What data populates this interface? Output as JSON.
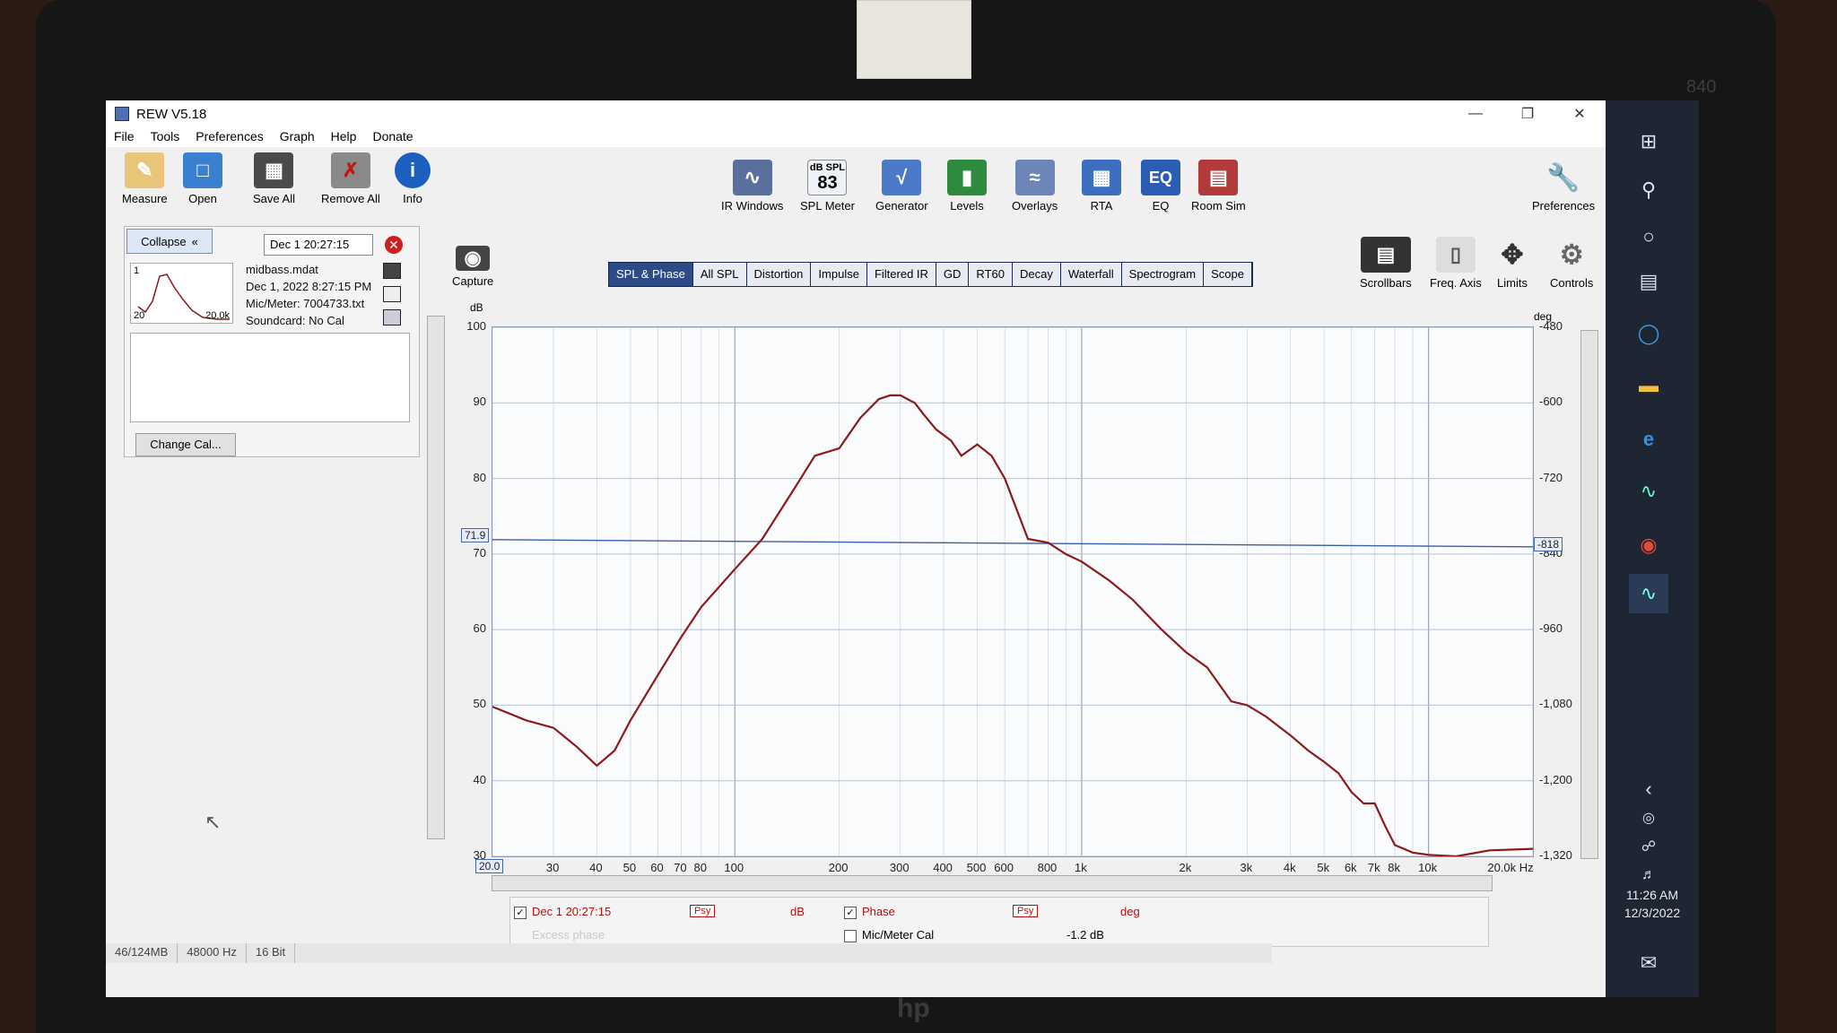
{
  "window": {
    "title": "REW V5.18"
  },
  "menu": [
    "File",
    "Tools",
    "Preferences",
    "Graph",
    "Help",
    "Donate"
  ],
  "toolbar": {
    "left": [
      {
        "label": "Measure",
        "icon": "measure-icon"
      },
      {
        "label": "Open",
        "icon": "folder-icon"
      },
      {
        "label": "Save All",
        "icon": "save-icon"
      },
      {
        "label": "Remove All",
        "icon": "remove-icon"
      },
      {
        "label": "Info",
        "icon": "info-icon"
      }
    ],
    "center": [
      {
        "label": "IR Windows",
        "icon": "ir-windows-icon"
      },
      {
        "label": "SPL Meter",
        "icon": "spl-meter-icon",
        "badge_top": "dB SPL",
        "badge_value": "83"
      },
      {
        "label": "Generator",
        "icon": "generator-icon"
      },
      {
        "label": "Levels",
        "icon": "levels-icon"
      },
      {
        "label": "Overlays",
        "icon": "overlays-icon"
      },
      {
        "label": "RTA",
        "icon": "rta-icon"
      },
      {
        "label": "EQ",
        "icon": "eq-icon"
      },
      {
        "label": "Room Sim",
        "icon": "room-sim-icon"
      }
    ],
    "preferences": "Preferences",
    "graph_right": [
      {
        "label": "Scrollbars"
      },
      {
        "label": "Freq. Axis"
      },
      {
        "label": "Limits"
      },
      {
        "label": "Controls"
      }
    ]
  },
  "panel": {
    "collapse": "Collapse",
    "collapse_glyph": "«",
    "measurement_time": "Dec 1 20:27:15",
    "index": "1",
    "thumb_left": "20",
    "thumb_right": "20.0k",
    "file": "midbass.mdat",
    "date": "Dec 1, 2022 8:27:15 PM",
    "mic": "Mic/Meter: 7004733.txt",
    "soundcard": "Soundcard: No Cal",
    "change_cal": "Change Cal..."
  },
  "capture": "Capture",
  "tabs": [
    {
      "label": "SPL & Phase",
      "active": true
    },
    {
      "label": "All SPL"
    },
    {
      "label": "Distortion"
    },
    {
      "label": "Impulse"
    },
    {
      "label": "Filtered IR"
    },
    {
      "label": "GD"
    },
    {
      "label": "RT60"
    },
    {
      "label": "Decay"
    },
    {
      "label": "Waterfall"
    },
    {
      "label": "Spectrogram"
    },
    {
      "label": "Scope"
    }
  ],
  "chart_data": {
    "type": "line",
    "ylabel": "dB",
    "y2label": "deg",
    "xscale": "log",
    "xlim": [
      20,
      20000
    ],
    "ylim": [
      30,
      100
    ],
    "y2lim": [
      -1320,
      -480
    ],
    "y_ticks": [
      30,
      40,
      50,
      60,
      70,
      80,
      90,
      100
    ],
    "y2_ticks": [
      "-480",
      "-600",
      "-720",
      "-840",
      "-960",
      "-1,080",
      "-1,200",
      "-1,320"
    ],
    "x_ticks": [
      "30",
      "40",
      "50",
      "60",
      "70",
      "80",
      "100",
      "200",
      "300",
      "400",
      "500",
      "600",
      "800",
      "1k",
      "2k",
      "3k",
      "4k",
      "5k",
      "6k",
      "7k",
      "8k",
      "10k"
    ],
    "x_min_label": "20.0",
    "x_max_label": "20.0k Hz",
    "cursor_left": "71.9",
    "cursor_right": "-818",
    "grid": true,
    "series": [
      {
        "name": "Dec 1 20:27:15",
        "color": "#8b1a1a",
        "x": [
          20,
          25,
          30,
          35,
          40,
          45,
          50,
          60,
          70,
          80,
          100,
          120,
          150,
          170,
          200,
          230,
          260,
          280,
          300,
          330,
          350,
          380,
          420,
          450,
          500,
          550,
          600,
          700,
          800,
          900,
          1000,
          1200,
          1400,
          1700,
          2000,
          2300,
          2700,
          3000,
          3400,
          4000,
          4500,
          5000,
          5500,
          6000,
          6500,
          7000,
          7500,
          8000,
          9000,
          10000,
          12000,
          15000,
          20000
        ],
        "y": [
          49.8,
          48,
          47,
          44.5,
          42,
          44,
          48,
          54,
          59,
          63,
          68,
          72,
          79,
          83,
          84,
          88,
          90.5,
          91,
          91,
          90,
          88.5,
          86.5,
          85,
          83,
          84.5,
          83,
          80,
          72,
          71.5,
          70,
          69,
          66.5,
          64,
          60,
          57,
          55,
          50.5,
          50,
          48.5,
          46,
          44,
          42.5,
          41,
          38.5,
          37,
          37,
          34,
          31.5,
          30.5,
          30.2,
          30,
          30.8,
          31
        ]
      }
    ]
  },
  "legend": {
    "m_label": "Dec 1 20:27:15",
    "psy": "Psy",
    "db": "dB",
    "phase": "Phase",
    "deg": "deg",
    "excess": "Excess phase",
    "mic_cal": "Mic/Meter Cal",
    "offset": "-1.2 dB"
  },
  "status": [
    "46/124MB",
    "48000 Hz",
    "16 Bit"
  ],
  "clock": {
    "time": "11:26 AM",
    "date": "12/3/2022"
  },
  "hardware": {
    "brand": "hp",
    "model": "840"
  }
}
